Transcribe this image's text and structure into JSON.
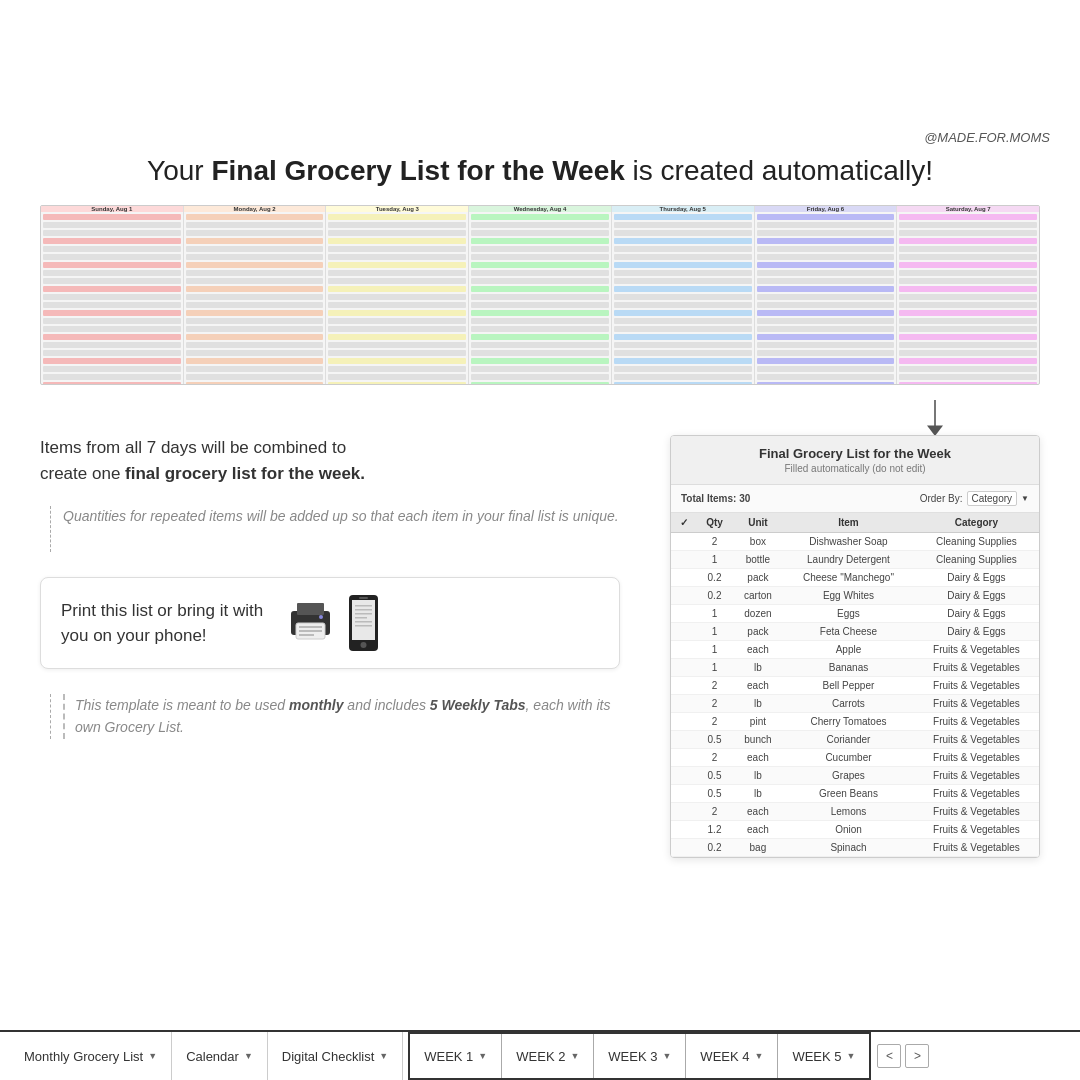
{
  "handle": "@MADE.FOR.MOMS",
  "headline": {
    "prefix": "Your ",
    "bold": "Final Grocery List for the Week",
    "suffix": " is created automatically!"
  },
  "days": [
    {
      "name": "Sunday, Aug 1",
      "colorClass": "dc-sunday"
    },
    {
      "name": "Monday, Aug 2",
      "colorClass": "dc-monday"
    },
    {
      "name": "Tuesday, Aug 3",
      "colorClass": "dc-tuesday"
    },
    {
      "name": "Wednesday, Aug 4",
      "colorClass": "dc-wednesday"
    },
    {
      "name": "Thursday, Aug 5",
      "colorClass": "dc-thursday"
    },
    {
      "name": "Friday, Aug 6",
      "colorClass": "dc-friday"
    },
    {
      "name": "Saturday, Aug 7",
      "colorClass": "dc-saturday"
    }
  ],
  "combine_text_1": "Items from all 7 days will be combined to",
  "combine_text_2": "create one ",
  "combine_text_bold": "final grocery list for the week.",
  "quantities_text": "Quantities for repeated items will be added up so that each item in your final list is unique.",
  "print_text_1": "Print this list or bring it with",
  "print_text_2": "you on your phone!",
  "monthly_text_1": "This template is meant to be used ",
  "monthly_bold_1": "monthly",
  "monthly_text_2": " and includes ",
  "monthly_bold_2": "5 Weekly Tabs",
  "monthly_text_3": ", each with its own Grocery List.",
  "panel": {
    "title": "Final Grocery List for the Week",
    "subtitle": "Filled automatically (do not edit)",
    "total_label": "Total Items: 30",
    "order_label": "Order By:",
    "order_value": "Category",
    "columns": [
      "✓",
      "Qty",
      "Unit",
      "Item",
      "Category"
    ],
    "rows": [
      {
        "check": "",
        "qty": "2",
        "unit": "box",
        "item": "Dishwasher Soap",
        "category": "Cleaning Supplies"
      },
      {
        "check": "",
        "qty": "1",
        "unit": "bottle",
        "item": "Laundry Detergent",
        "category": "Cleaning Supplies"
      },
      {
        "check": "",
        "qty": "0.2",
        "unit": "pack",
        "item": "Cheese \"Manchego\"",
        "category": "Dairy & Eggs"
      },
      {
        "check": "",
        "qty": "0.2",
        "unit": "carton",
        "item": "Egg Whites",
        "category": "Dairy & Eggs"
      },
      {
        "check": "",
        "qty": "1",
        "unit": "dozen",
        "item": "Eggs",
        "category": "Dairy & Eggs"
      },
      {
        "check": "",
        "qty": "1",
        "unit": "pack",
        "item": "Feta Cheese",
        "category": "Dairy & Eggs"
      },
      {
        "check": "",
        "qty": "1",
        "unit": "each",
        "item": "Apple",
        "category": "Fruits & Vegetables"
      },
      {
        "check": "",
        "qty": "1",
        "unit": "lb",
        "item": "Bananas",
        "category": "Fruits & Vegetables"
      },
      {
        "check": "",
        "qty": "2",
        "unit": "each",
        "item": "Bell Pepper",
        "category": "Fruits & Vegetables"
      },
      {
        "check": "",
        "qty": "2",
        "unit": "lb",
        "item": "Carrots",
        "category": "Fruits & Vegetables"
      },
      {
        "check": "",
        "qty": "2",
        "unit": "pint",
        "item": "Cherry Tomatoes",
        "category": "Fruits & Vegetables"
      },
      {
        "check": "",
        "qty": "0.5",
        "unit": "bunch",
        "item": "Coriander",
        "category": "Fruits & Vegetables"
      },
      {
        "check": "",
        "qty": "2",
        "unit": "each",
        "item": "Cucumber",
        "category": "Fruits & Vegetables"
      },
      {
        "check": "",
        "qty": "0.5",
        "unit": "lb",
        "item": "Grapes",
        "category": "Fruits & Vegetables"
      },
      {
        "check": "",
        "qty": "0.5",
        "unit": "lb",
        "item": "Green Beans",
        "category": "Fruits & Vegetables"
      },
      {
        "check": "",
        "qty": "2",
        "unit": "each",
        "item": "Lemons",
        "category": "Fruits & Vegetables"
      },
      {
        "check": "",
        "qty": "1.2",
        "unit": "each",
        "item": "Onion",
        "category": "Fruits & Vegetables"
      },
      {
        "check": "",
        "qty": "0.2",
        "unit": "bag",
        "item": "Spinach",
        "category": "Fruits & Vegetables"
      }
    ]
  },
  "tabs": {
    "main": [
      {
        "label": "Monthly Grocery List",
        "arrow": "▼"
      },
      {
        "label": "Calendar",
        "arrow": "▼"
      },
      {
        "label": "Digital Checklist",
        "arrow": "▼"
      }
    ],
    "weeks": [
      {
        "label": "WEEK 1",
        "arrow": "▼"
      },
      {
        "label": "WEEK 2",
        "arrow": "▼"
      },
      {
        "label": "WEEK 3",
        "arrow": "▼"
      },
      {
        "label": "WEEK 4",
        "arrow": "▼"
      },
      {
        "label": "WEEK 5",
        "arrow": "▼"
      }
    ],
    "nav": [
      "<",
      ">"
    ]
  }
}
